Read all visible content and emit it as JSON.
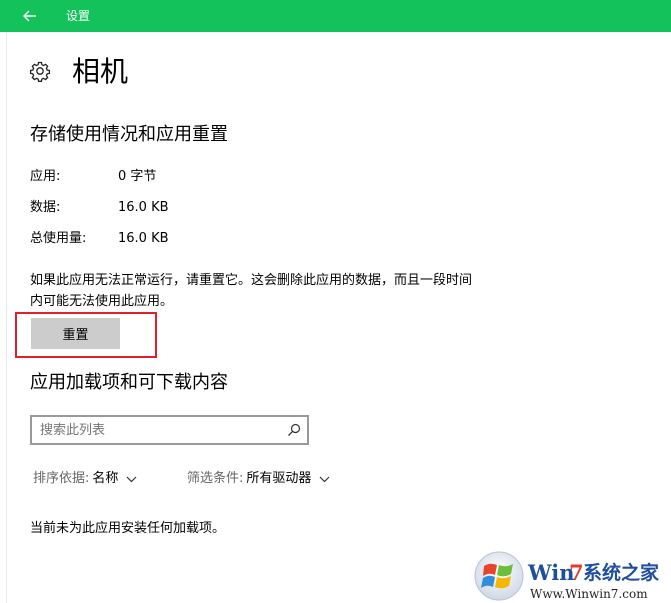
{
  "titlebar": {
    "back_icon": "arrow-left-icon",
    "title": "设置",
    "color": "#13c25b"
  },
  "header": {
    "icon": "gear-icon",
    "title": "相机"
  },
  "storage": {
    "heading": "存储使用情况和应用重置",
    "rows": [
      {
        "label": "应用:",
        "value": "0 字节"
      },
      {
        "label": "数据:",
        "value": "16.0 KB"
      },
      {
        "label": "总使用量:",
        "value": "16.0 KB"
      }
    ],
    "description": "如果此应用无法正常运行，请重置它。这会删除此应用的数据，而且一段时间内可能无法使用此应用。",
    "reset_label": "重置"
  },
  "addons": {
    "heading": "应用加载项和可下载内容",
    "search_placeholder": "搜索此列表",
    "sort_label": "排序依据:",
    "sort_value": "名称",
    "filter_label": "筛选条件:",
    "filter_value": "所有驱动器",
    "empty_message": "当前未为此应用安装任何加载项。"
  },
  "watermark": {
    "brand_prefix": "Win",
    "brand_num": "7",
    "brand_cn": "系统之家",
    "url": "Www.Winwin7.com"
  }
}
